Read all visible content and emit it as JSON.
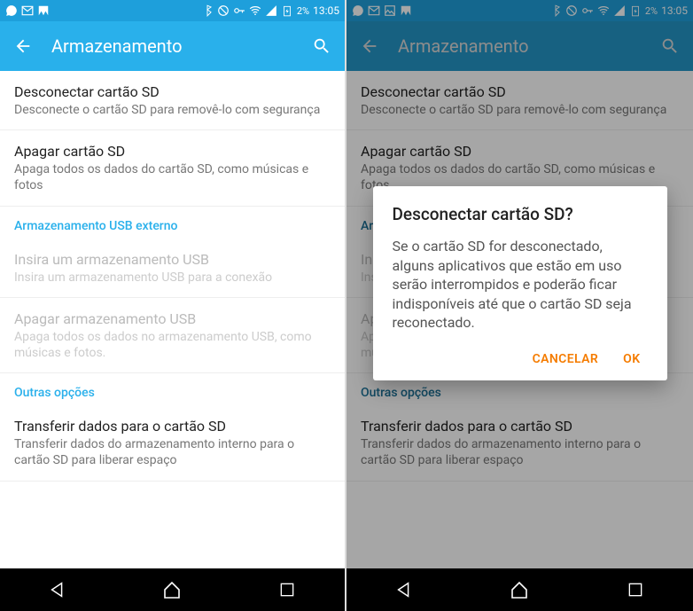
{
  "status": {
    "time": "13:05",
    "battery": "2%"
  },
  "header": {
    "title": "Armazenamento"
  },
  "items": {
    "disconnect": {
      "title": "Desconectar cartão SD",
      "sub": "Desconecte o cartão SD para removê-lo com segurança"
    },
    "erase": {
      "title": "Apagar cartão SD",
      "sub": "Apaga todos os dados do cartão SD, como músicas e fotos"
    },
    "section_usb": "Armazenamento USB externo",
    "insert_usb": {
      "title": "Insira um armazenamento USB",
      "sub": "Insira um armazenamento USB para a conexão"
    },
    "erase_usb": {
      "title": "Apagar armazenamento USB",
      "sub": "Apaga todos os dados no armazenamento USB, como músicas e fotos."
    },
    "section_other": "Outras opções",
    "transfer": {
      "title": "Transferir dados para o cartão SD",
      "sub": "Transferir dados do armazenamento interno para o cartão SD para liberar espaço"
    }
  },
  "dialog": {
    "title": "Desconectar cartão SD?",
    "message": "Se o cartão SD for desconectado, alguns aplicativos que estão em uso serão interrompidos e poderão ficar indisponíveis até que o cartão SD seja reconectado.",
    "cancel": "CANCELAR",
    "ok": "OK"
  }
}
